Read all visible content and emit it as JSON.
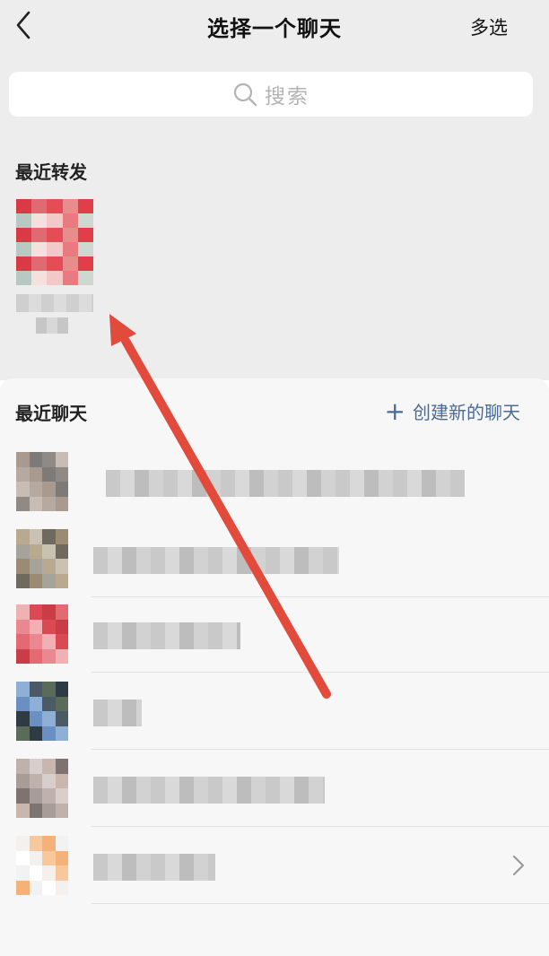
{
  "nav": {
    "title": "选择一个聊天",
    "multi_select": "多选"
  },
  "search": {
    "placeholder": "搜索"
  },
  "recent_forward": {
    "heading": "最近转发"
  },
  "recent_chats": {
    "heading": "最近聊天",
    "new_chat": "创建新的聊天",
    "rows": 6
  },
  "colors": {
    "accent_link": "#4a6a98",
    "arrow": "#e24a3b",
    "bg_gray": "#ededed"
  }
}
